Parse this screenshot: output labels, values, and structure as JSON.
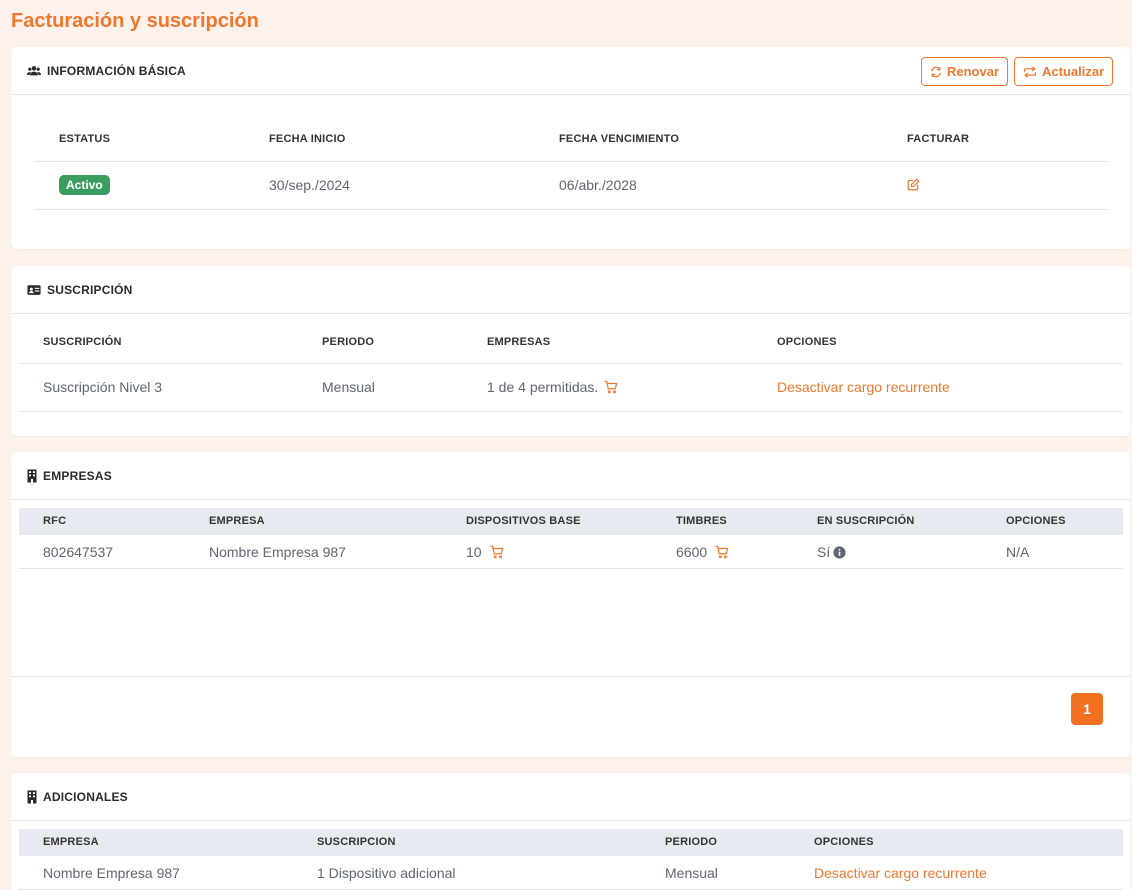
{
  "page": {
    "title": "Facturación y suscripción"
  },
  "basic_info": {
    "title": "INFORMACIÓN BÁSICA",
    "renew_label": "Renovar",
    "update_label": "Actualizar",
    "headers": {
      "status": "ESTATUS",
      "start": "FECHA INICIO",
      "expiry": "FECHA VENCIMIENTO",
      "invoice": "FACTURAR"
    },
    "row": {
      "status": "Activo",
      "start": "30/sep./2024",
      "expiry": "06/abr./2028"
    }
  },
  "subscription": {
    "title": "SUSCRIPCIÓN",
    "headers": {
      "subscription": "SUSCRIPCIÓN",
      "period": "PERIODO",
      "companies": "EMPRESAS",
      "options": "OPCIONES"
    },
    "row": {
      "subscription": "Suscripción Nivel 3",
      "period": "Mensual",
      "companies": "1 de 4 permitidas.",
      "option": "Desactivar cargo recurrente"
    }
  },
  "companies": {
    "title": "EMPRESAS",
    "headers": {
      "rfc": "RFC",
      "company": "EMPRESA",
      "devices": "DISPOSITIVOS BASE",
      "stamps": "TIMBRES",
      "in_sub": "EN SUSCRIPCIÓN",
      "options": "OPCIONES"
    },
    "row": {
      "rfc": "802647537",
      "company": "Nombre Empresa 987",
      "devices": "10",
      "stamps": "6600",
      "in_sub": "Sí",
      "options": "N/A"
    },
    "pagination": {
      "page": "1"
    }
  },
  "additionals": {
    "title": "ADICIONALES",
    "headers": {
      "company": "EMPRESA",
      "subscription": "SUSCRIPCION",
      "period": "PERIODO",
      "options": "OPCIONES"
    },
    "row": {
      "company": "Nombre Empresa 987",
      "subscription": "1 Dispositivo adicional",
      "period": "Mensual",
      "option": "Desactivar cargo recurrente"
    }
  },
  "colors": {
    "accent": "#f0782e",
    "success": "#3a9d5d",
    "background": "#fdf1ec"
  },
  "icons": [
    "users-icon",
    "id-card-icon",
    "building-icon",
    "sync-icon",
    "repeat-icon",
    "edit-icon",
    "cart-icon",
    "info-icon"
  ]
}
